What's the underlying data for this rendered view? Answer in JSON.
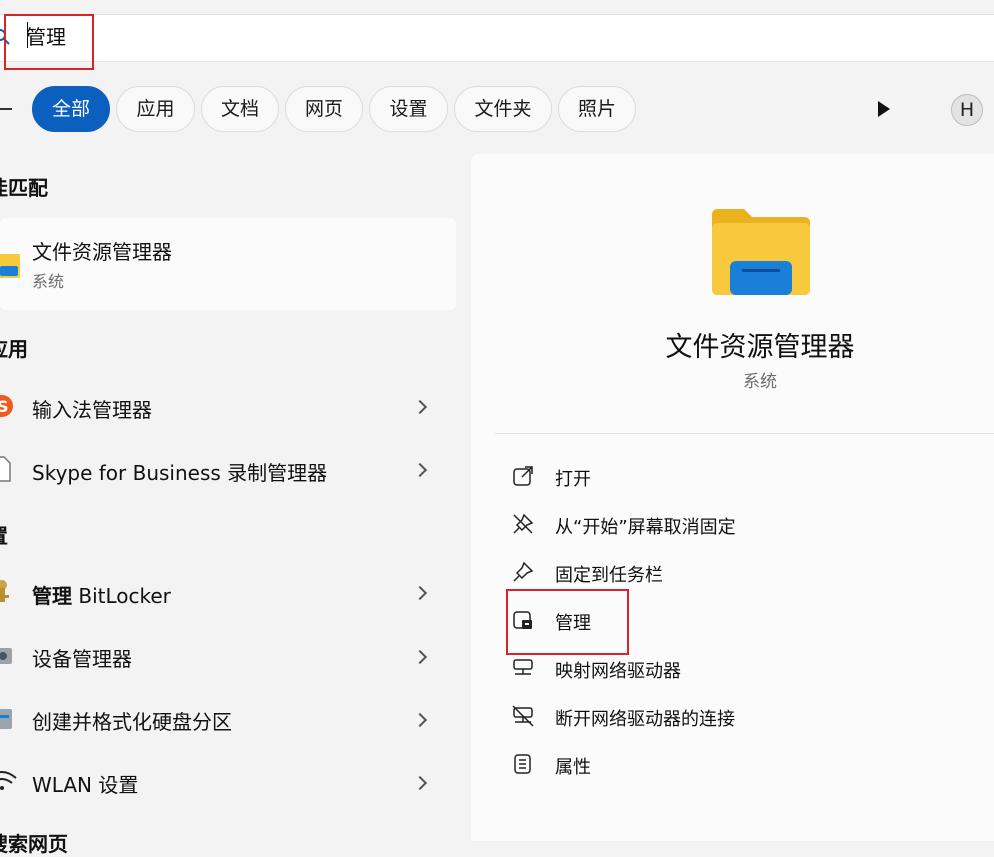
{
  "search": {
    "query": "管理"
  },
  "filters": {
    "tabs": [
      {
        "label": "全部",
        "active": true
      },
      {
        "label": "应用"
      },
      {
        "label": "文档"
      },
      {
        "label": "网页"
      },
      {
        "label": "设置"
      },
      {
        "label": "文件夹"
      },
      {
        "label": "照片"
      }
    ],
    "avatar": "H"
  },
  "left": {
    "best_match_heading": "佳匹配",
    "best_match": {
      "title": "文件资源管理器",
      "subtitle": "系统"
    },
    "apps_heading": "应用",
    "apps": [
      {
        "title": "输入法管理器"
      },
      {
        "title": "Skype for Business 录制管理器"
      }
    ],
    "settings_heading": "置",
    "settings": [
      {
        "bold": "管理",
        "rest": " BitLocker"
      },
      {
        "title": "设备管理器"
      },
      {
        "title": "创建并格式化硬盘分区"
      },
      {
        "title": "WLAN 设置"
      }
    ],
    "web_heading": "搜索网页"
  },
  "detail": {
    "title": "文件资源管理器",
    "subtitle": "系统",
    "actions": [
      {
        "label": "打开",
        "icon": "open-external-icon"
      },
      {
        "label": "从“开始”屏幕取消固定",
        "icon": "unpin-icon"
      },
      {
        "label": "固定到任务栏",
        "icon": "pin-icon"
      },
      {
        "label": "管理",
        "icon": "manage-icon"
      },
      {
        "label": "映射网络驱动器",
        "icon": "map-drive-icon"
      },
      {
        "label": "断开网络驱动器的连接",
        "icon": "disconnect-drive-icon"
      },
      {
        "label": "属性",
        "icon": "properties-icon"
      }
    ]
  },
  "colors": {
    "accent": "#0a5fbf",
    "highlight_box": "#d8232a",
    "folder": "#f8c93c"
  }
}
